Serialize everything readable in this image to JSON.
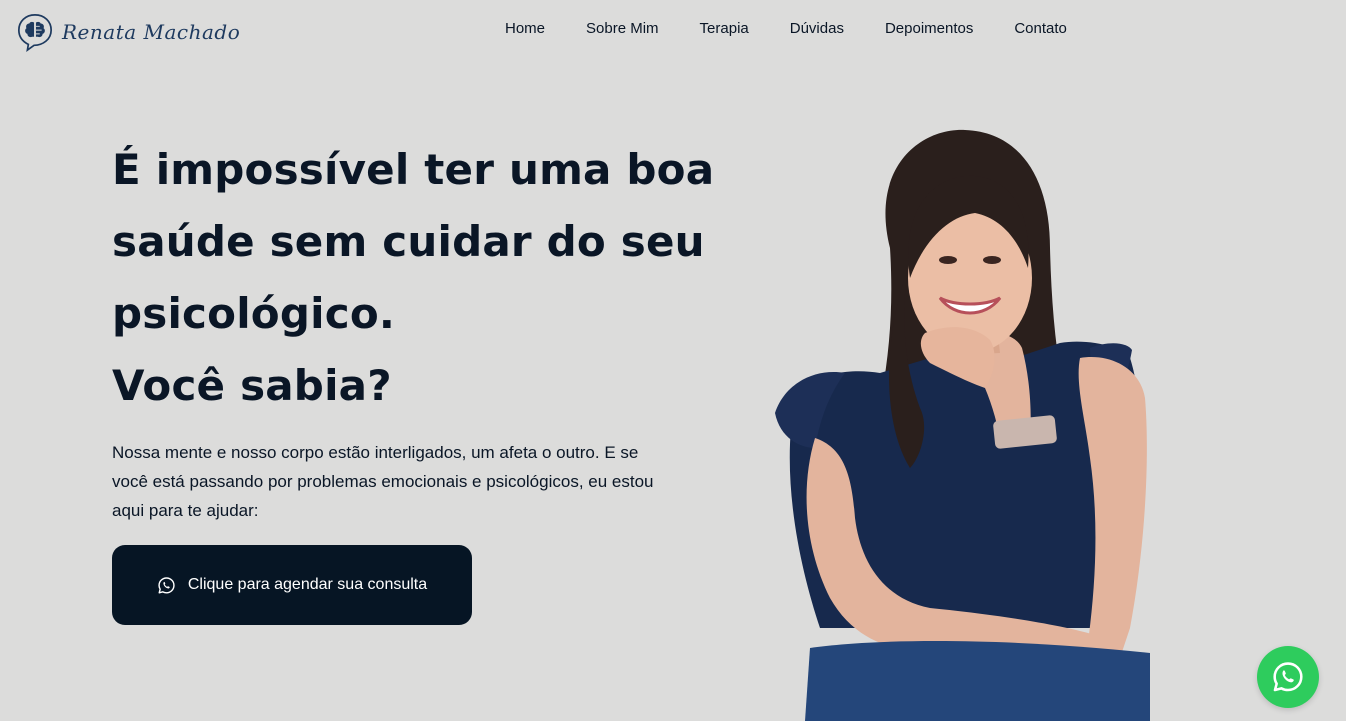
{
  "brand": {
    "name": "Renata Machado"
  },
  "nav": {
    "items": [
      {
        "label": "Home"
      },
      {
        "label": "Sobre Mim"
      },
      {
        "label": "Terapia"
      },
      {
        "label": "Dúvidas"
      },
      {
        "label": "Depoimentos"
      },
      {
        "label": "Contato"
      }
    ]
  },
  "hero": {
    "title_lines": [
      "É impossível ter uma boa",
      "saúde sem cuidar do seu",
      "psicológico.",
      "Você sabia?"
    ],
    "text": "Nossa mente e nosso corpo estão interligados, um afeta o outro. E se você está passando por problemas emocionais e psicológicos, eu estou aqui para te ajudar:",
    "cta_label": "Clique para agendar sua consulta",
    "cta_icon": "whatsapp-icon"
  },
  "floating": {
    "icon": "whatsapp-icon"
  },
  "colors": {
    "background": "#dcdcdb",
    "brand_navy": "#1e3a5f",
    "cta_bg": "#061524",
    "whatsapp_green": "#2ecc5d"
  }
}
